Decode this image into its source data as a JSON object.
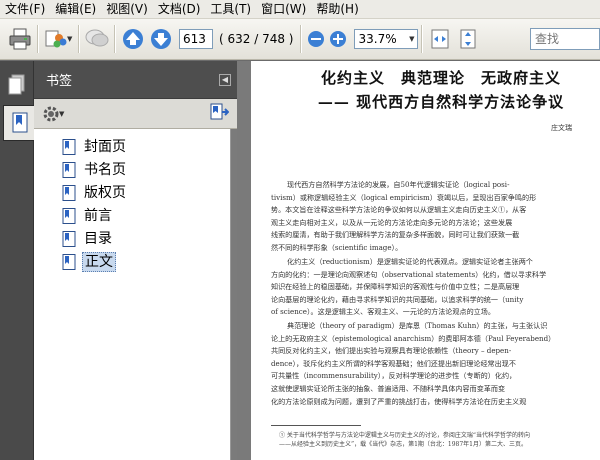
{
  "menu": [
    "文件(F)",
    "编辑(E)",
    "视图(V)",
    "文档(D)",
    "工具(T)",
    "窗口(W)",
    "帮助(H)"
  ],
  "toolbar": {
    "page_number": "613",
    "page_count": "( 632 / 748 )",
    "zoom": "33.7%",
    "search_placeholder": "查找"
  },
  "panel": {
    "title": "书签",
    "bookmarks": [
      "封面页",
      "书名页",
      "版权页",
      "前言",
      "目录",
      "正文"
    ],
    "selected_index": 5
  },
  "document": {
    "title_line1": "化约主义　典范理论　无政府主义",
    "title_line2": "—— 现代西方自然科学方法论争议",
    "author": "庄文瑞",
    "paragraphs": [
      [
        "现代西方自然科学方法论的发展，自50年代逻辑实证论（logical posi-",
        "tivism）或称逻辑经验主义（logical empiricism）衰竭以后，呈现出百家争鸣的形",
        "势。本文旨在诠释这些科学方法论的争议如何以从逻辑主义走向历史主义①，从客",
        "观主义走向相对主义，以及从一元论的方法论走向多元论的方法论；这些发展",
        "线索的厘清，有助于我们理解科学方法的复杂多样面貌，同时可让我们获致一截",
        "然不同的科学形象（scientific image）。"
      ],
      [
        "化约主义（reductionism）是逻辑实证论的代表观点。逻辑实证论者主张两个",
        "方向的化约：一是理论向观察述句（observational statements）化约，借以寻求科学",
        "知识在经验上的稳固基础，并保障科学知识的客观性与价值中立性；二是高层理",
        "论向基层的理论化约，藉由寻求科学知识的共同基础，以追求科学的统一（unity",
        "of science）。这是逻辑主义、客观主义、一元论的方法论观点的立场。"
      ],
      [
        "典范理论（theory of paradigm）是库恩（Thomas Kuhn）的主张，与主张认识",
        "论上的无政府主义（epistemological anarchism）的费耶阿本德（Paul Feyerabend）",
        "共同反对化约主义，他们提出实验与观察具有理论依赖性（theory – depen-",
        "dence），驳斥化约主义所谓的科学客观基础；他们还提出新旧理论经常出现不",
        "可共量性（incommensurability），反对科学理论的进步性（专断的）化约，",
        "这就使逻辑实证论所主张的抽象、普遍适用、不随科学具体内容而变革而变",
        "化的方法论原则成为问题，遭到了严重的挑战打击，使得科学方法论在历史主义观"
      ]
    ],
    "footnote": [
      "① 关于当代科学哲学与方法论中逻辑主义与历史主义的讨论，参阅庄文瑞“当代科学哲学的转向",
      "——从经验主义到历史主义”，载《当代》杂志，第1期（台北：1987年1月）第二大、三页。"
    ]
  }
}
